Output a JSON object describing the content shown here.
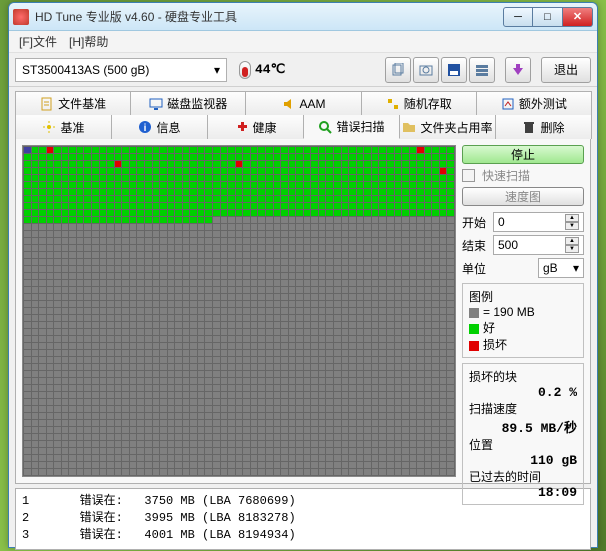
{
  "titlebar": {
    "title": "HD Tune 专业版 v4.60 - 硬盘专业工具"
  },
  "menu": {
    "file": "[F]文件",
    "help": "[H]帮助"
  },
  "toolbar": {
    "drive": "ST3500413AS (500 gB)",
    "temp": "44℃",
    "exit": "退出"
  },
  "tabs": {
    "row1": [
      {
        "label": "文件基准",
        "icon": "file-benchmark-icon"
      },
      {
        "label": "磁盘监视器",
        "icon": "monitor-icon"
      },
      {
        "label": "AAM",
        "icon": "speaker-icon"
      },
      {
        "label": "随机存取",
        "icon": "random-icon"
      },
      {
        "label": "额外测试",
        "icon": "extra-icon"
      }
    ],
    "row2": [
      {
        "label": "基准",
        "icon": "benchmark-icon"
      },
      {
        "label": "信息",
        "icon": "info-icon"
      },
      {
        "label": "健康",
        "icon": "health-icon"
      },
      {
        "label": "错误扫描",
        "icon": "error-scan-icon",
        "active": true
      },
      {
        "label": "文件夹占用率",
        "icon": "folder-icon"
      },
      {
        "label": "删除",
        "icon": "delete-icon"
      }
    ]
  },
  "side": {
    "stop": "停止",
    "quickscan": "快速扫描",
    "speedmap": "速度图",
    "start_label": "开始",
    "start_val": "0",
    "end_label": "结束",
    "end_val": "500",
    "unit_label": "单位",
    "unit_val": "gB",
    "legend_title": "图例",
    "legend_block": "= 190 MB",
    "legend_good": "好",
    "legend_bad": "损坏",
    "damaged_label": "损坏的块",
    "damaged_val": "0.2 %",
    "speed_label": "扫描速度",
    "speed_val": "89.5 MB/秒",
    "pos_label": "位置",
    "pos_val": "110 gB",
    "elapsed_label": "已过去的时间",
    "elapsed_val": "18:09"
  },
  "errors": [
    {
      "idx": "1",
      "label": "错误在:",
      "mb": "3750 MB",
      "lba": "(LBA 7680699)"
    },
    {
      "idx": "2",
      "label": "错误在:",
      "mb": "3995 MB",
      "lba": "(LBA 8183278)"
    },
    {
      "idx": "3",
      "label": "错误在:",
      "mb": "4001 MB",
      "lba": "(LBA 8194934)"
    }
  ]
}
